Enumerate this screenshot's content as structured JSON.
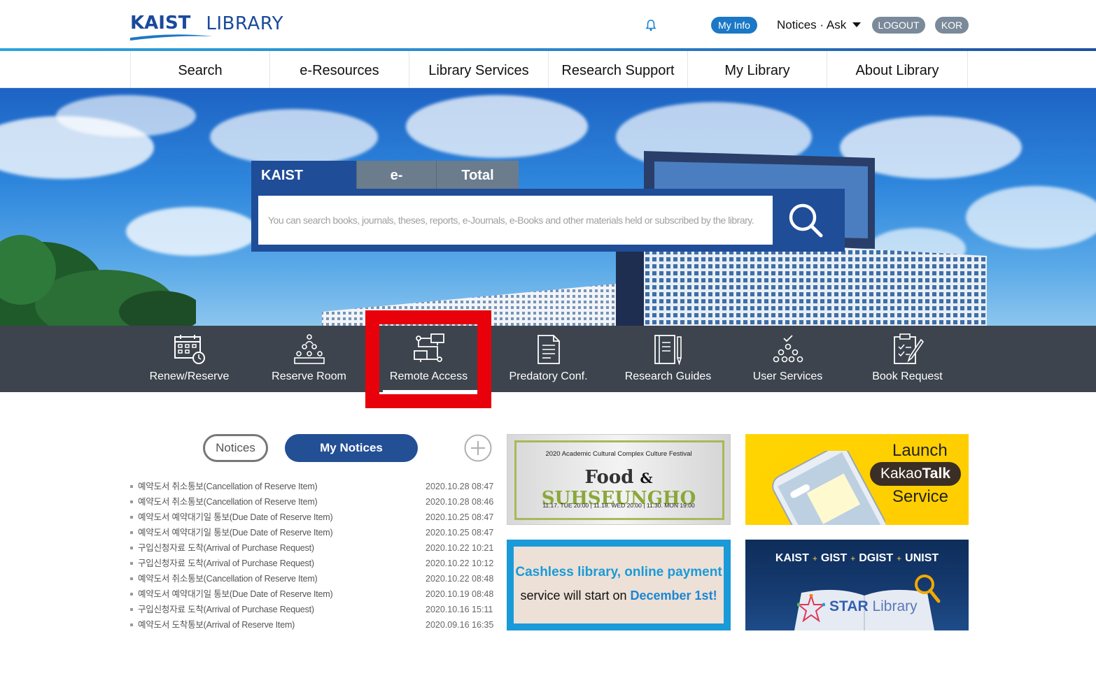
{
  "header": {
    "logo_kaist": "KAIST",
    "logo_library": "LIBRARY",
    "my_info": "My Info",
    "notices_ask": "Notices · Ask",
    "logout": "LOGOUT",
    "lang": "KOR"
  },
  "nav": {
    "items": [
      {
        "label": "Search"
      },
      {
        "label": "e-Resources"
      },
      {
        "label": "Library Services"
      },
      {
        "label": "Research Support"
      },
      {
        "label": "My Library"
      },
      {
        "label": "About Library"
      }
    ]
  },
  "search": {
    "tabs": [
      {
        "label": "KAIST Catalog"
      },
      {
        "label": "e-Articles"
      },
      {
        "label": "Total Search"
      }
    ],
    "placeholder": "You can search books, journals, theses, reports, e-Journals, e-Books and other materials held or subscribed by the library."
  },
  "quick_menu": {
    "items": [
      {
        "label": "Renew/Reserve",
        "icon": "calendar-clock-icon"
      },
      {
        "label": "Reserve Room",
        "icon": "people-group-icon"
      },
      {
        "label": "Remote Access",
        "icon": "network-computers-icon"
      },
      {
        "label": "Predatory Conf.",
        "icon": "document-icon"
      },
      {
        "label": "Research Guides",
        "icon": "book-pen-icon"
      },
      {
        "label": "User Services",
        "icon": "users-network-icon"
      },
      {
        "label": "Book Request",
        "icon": "clipboard-pen-icon"
      }
    ],
    "highlight_color": "#e8000a"
  },
  "notices": {
    "tab_notices": "Notices",
    "tab_my_notices": "My Notices",
    "items": [
      {
        "title": "예약도서 취소통보(Cancellation of Reserve Item)",
        "date": "2020.10.28 08:47"
      },
      {
        "title": "예약도서 취소통보(Cancellation of Reserve Item)",
        "date": "2020.10.28 08:46"
      },
      {
        "title": "예약도서 예약대기일 통보(Due Date of Reserve Item)",
        "date": "2020.10.25 08:47"
      },
      {
        "title": "예약도서 예약대기일 통보(Due Date of Reserve Item)",
        "date": "2020.10.25 08:47"
      },
      {
        "title": "구입신청자료 도착(Arrival of Purchase Request)",
        "date": "2020.10.22 10:21"
      },
      {
        "title": "구입신청자료 도착(Arrival of Purchase Request)",
        "date": "2020.10.22 10:12"
      },
      {
        "title": "예약도서 취소통보(Cancellation of Reserve Item)",
        "date": "2020.10.22 08:48"
      },
      {
        "title": "예약도서 예약대기일 통보(Due Date of Reserve Item)",
        "date": "2020.10.19 08:48"
      },
      {
        "title": "구입신청자료 도착(Arrival of Purchase Request)",
        "date": "2020.10.16 15:11"
      },
      {
        "title": "예약도서 도착통보(Arrival of Reserve Item)",
        "date": "2020.09.16 16:35"
      }
    ]
  },
  "banners": {
    "festival": {
      "top": "2020 Academic Cultural Complex Culture Festival",
      "title_a": "Food",
      "title_amp": "&",
      "title_b": "SUHSEUNGHO",
      "dates": "11.17. TUE 20:00  |  11.18. WED 20:00  |  11.30. MON 19:00"
    },
    "kakao": {
      "launch": "Launch",
      "kakao": "Kakao",
      "talk": "Talk",
      "service": "Service"
    },
    "cashless": {
      "line1": "Cashless library, online payment",
      "line2_a": "service will start on",
      "line2_b": "December 1st!"
    },
    "star": {
      "k": "KAIST",
      "g": "GIST",
      "d": "DGIST",
      "u": "UNIST",
      "plus": "+",
      "star": "STAR",
      "library": "Library"
    }
  }
}
